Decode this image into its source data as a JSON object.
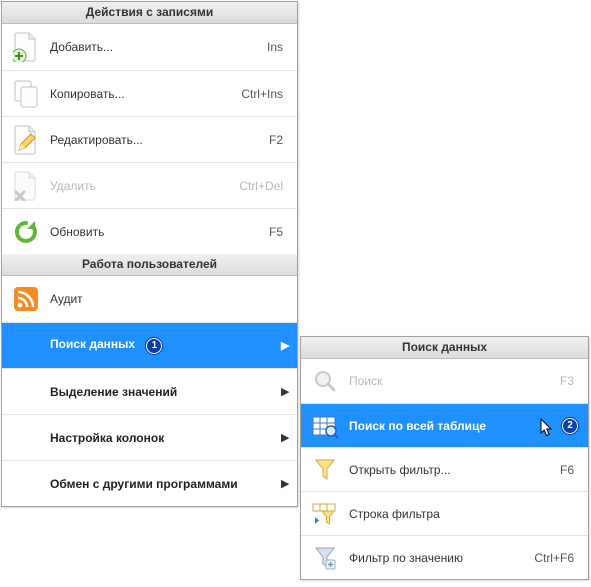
{
  "main": {
    "sections": [
      {
        "title": "Действия с записями"
      },
      {
        "title": "Работа пользователей"
      }
    ],
    "items": {
      "add": {
        "label": "Добавить...",
        "shortcut": "Ins"
      },
      "copy": {
        "label": "Копировать...",
        "shortcut": "Ctrl+Ins"
      },
      "edit": {
        "label": "Редактировать...",
        "shortcut": "F2"
      },
      "delete": {
        "label": "Удалить",
        "shortcut": "Ctrl+Del"
      },
      "refresh": {
        "label": "Обновить",
        "shortcut": "F5"
      },
      "audit": {
        "label": "Аудит"
      },
      "search": {
        "label": "Поиск данных",
        "badge": "1"
      },
      "highlight": {
        "label": "Выделение значений"
      },
      "columns": {
        "label": "Настройка колонок"
      },
      "exchange": {
        "label": "Обмен с другими программами"
      }
    }
  },
  "sub": {
    "title": "Поиск данных",
    "items": {
      "find": {
        "label": "Поиск",
        "shortcut": "F3"
      },
      "findall": {
        "label": "Поиск по всей таблице",
        "badge": "2"
      },
      "openfilter": {
        "label": "Открыть фильтр...",
        "shortcut": "F6"
      },
      "filterrow": {
        "label": "Строка фильтра"
      },
      "filterval": {
        "label": "Фильтр по значению",
        "shortcut": "Ctrl+F6"
      }
    }
  }
}
